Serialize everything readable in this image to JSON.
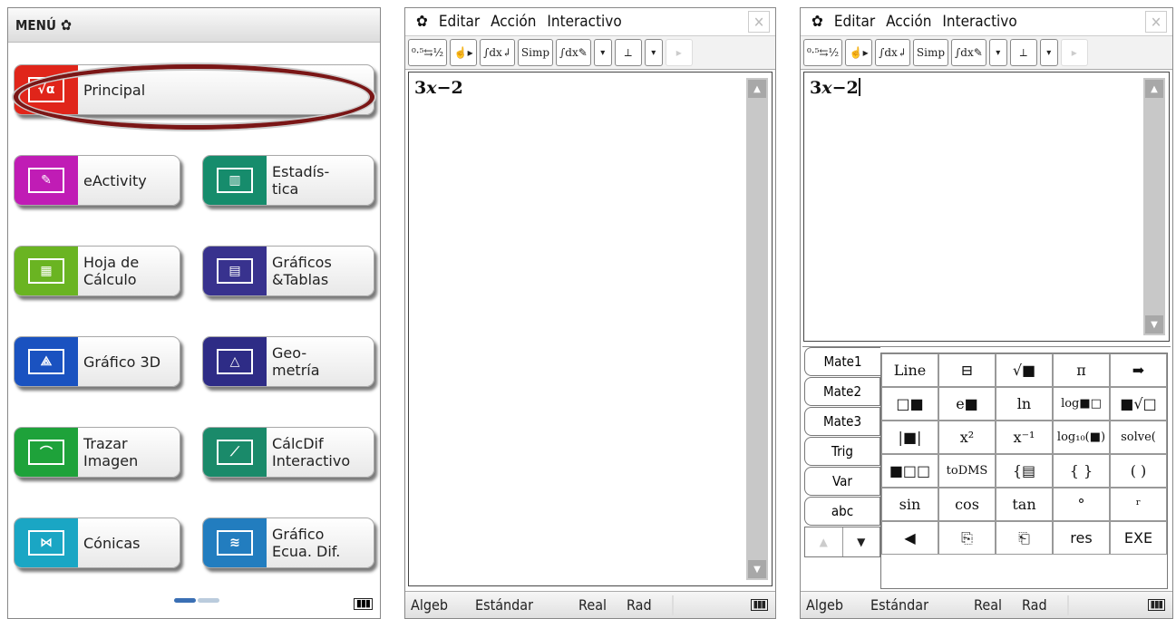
{
  "menu_screen": {
    "title": "MENÚ",
    "items": [
      {
        "label": "Principal",
        "icon": "sqrt-alpha-icon",
        "icon_text": "√α",
        "color": "#e0251a"
      },
      {
        "label": "eActivity",
        "icon": "eactivity-icon",
        "icon_text": "✎",
        "color": "#c01cb5"
      },
      {
        "label": "Estadís-\ntica",
        "icon": "statistics-icon",
        "icon_text": "▥",
        "color": "#168c6c"
      },
      {
        "label": "Hoja de\nCálculo",
        "icon": "spreadsheet-icon",
        "icon_text": "▦",
        "color": "#6ab422"
      },
      {
        "label": "Gráficos\n&Tablas",
        "icon": "graph-table-icon",
        "icon_text": "▤",
        "color": "#38328e"
      },
      {
        "label": "Gráfico 3D",
        "icon": "graph-3d-icon",
        "icon_text": "⟁",
        "color": "#1a52c0"
      },
      {
        "label": "Geo-\nmetría",
        "icon": "geometry-icon",
        "icon_text": "△",
        "color": "#2e2c86"
      },
      {
        "label": "Trazar\nImagen",
        "icon": "picture-plot-icon",
        "icon_text": "⌒",
        "color": "#1ea23a"
      },
      {
        "label": "CálcDif\nInteractivo",
        "icon": "diffcalc-icon",
        "icon_text": "⟋",
        "color": "#1a8a6a"
      },
      {
        "label": "Cónicas",
        "icon": "conics-icon",
        "icon_text": "⋈",
        "color": "#1aa6c4"
      },
      {
        "label": "Gráfico\nEcua. Dif.",
        "icon": "diffeq-icon",
        "icon_text": "≋",
        "color": "#227dbf"
      }
    ]
  },
  "calc": {
    "menus": [
      "Editar",
      "Acción",
      "Interactivo"
    ],
    "toolbar": [
      "⁰·⁵⇆½",
      "☝▸",
      "∫dx↲",
      "Simp",
      "∫dx✎",
      "▾",
      "⟂",
      "▾",
      "▸"
    ],
    "expression_base": "3",
    "expression_var": "x",
    "expression_tail": "−2",
    "status": {
      "mode": "Algeb",
      "format": "Estándar",
      "domain": "Real",
      "angle": "Rad"
    }
  },
  "keyboard": {
    "tabs": [
      "Mate1",
      "Mate2",
      "Mate3",
      "Trig",
      "Var",
      "abc"
    ],
    "keys": [
      "Line",
      "⊟",
      "√■",
      "π",
      "➡",
      "□■",
      "e■",
      "ln",
      "log■□",
      "■√□",
      "|■|",
      "x²",
      "x⁻¹",
      "log₁₀(■)",
      "solve(",
      "■□□",
      "toDMS",
      "{▤",
      "{ }",
      "( )",
      "sin",
      "cos",
      "tan",
      "°",
      "ʳ",
      "◀",
      "⎘",
      "⎗",
      "res",
      "EXE"
    ],
    "nav": [
      "▲",
      "▼"
    ]
  }
}
